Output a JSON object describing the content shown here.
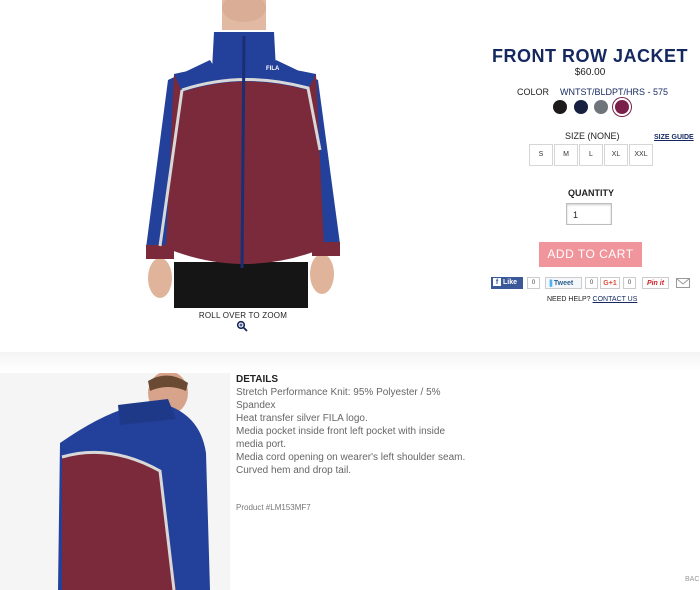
{
  "product": {
    "title": "FRONT ROW JACKET",
    "price": "$60.00"
  },
  "image": {
    "zoom_text": "ROLL OVER TO ZOOM",
    "logo_text": "FILA"
  },
  "color": {
    "label": "COLOR",
    "value": "WNTST/BLDPT/HRS - 575",
    "swatches": [
      {
        "name": "black",
        "hex": "#1e1a1c"
      },
      {
        "name": "navy",
        "hex": "#172040"
      },
      {
        "name": "grey",
        "hex": "#6e7479"
      },
      {
        "name": "maroon",
        "hex": "#7a1f4a",
        "selected": true
      }
    ]
  },
  "size": {
    "label": "SIZE (NONE)",
    "guide_link": "SIZE GUIDE",
    "options": [
      "S",
      "M",
      "L",
      "XL",
      "XXL"
    ]
  },
  "quantity": {
    "label": "QUANTITY",
    "value": "1"
  },
  "cart": {
    "button_label": "ADD TO CART"
  },
  "share": {
    "like_label": "Like",
    "like_count": "0",
    "tweet_label": "Tweet",
    "tweet_count": "0",
    "gplus_label": "G+1",
    "gplus_count": "0",
    "pin_label": "Pin it",
    "pin_count": "0"
  },
  "help": {
    "text": "NEED HELP?",
    "link": "CONTACT US"
  },
  "details": {
    "title": "DETAILS",
    "items": [
      "Stretch Performance Knit: 95% Polyester / 5% Spandex",
      "Heat transfer silver FILA logo.",
      "Media pocket inside front left pocket with inside media port.",
      "Media cord opening on wearer's left shoulder seam.",
      "Curved hem and drop tail."
    ],
    "product_number": "Product #LM153MF7"
  },
  "footer": {
    "back_label": "BAC"
  },
  "colors": {
    "brand_navy": "#14285f",
    "cart_pink": "#f1959c",
    "jacket_maroon": "#7a2a3a",
    "jacket_blue": "#23419a"
  }
}
